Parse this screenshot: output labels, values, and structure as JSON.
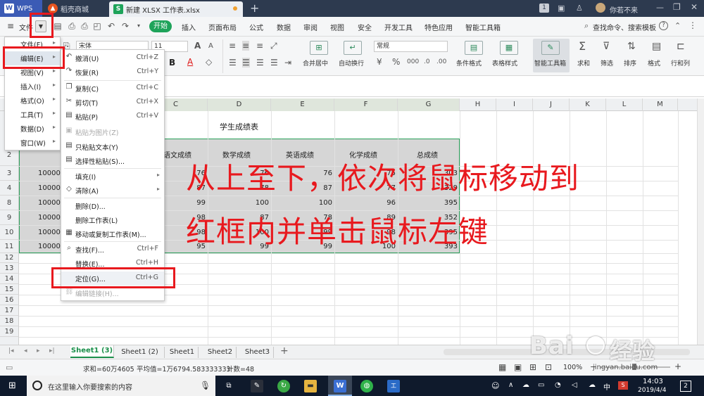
{
  "titlebar": {
    "tabs": [
      {
        "label": "WPS"
      },
      {
        "label": "稻壳商城"
      },
      {
        "label": "新建 XLSX 工作表.xlsx"
      }
    ],
    "page_count": "1",
    "user": "你若不来"
  },
  "menubar": {
    "file_label": "文件",
    "start_label": "开始",
    "items": [
      "插入",
      "页面布局",
      "公式",
      "数据",
      "审阅",
      "视图",
      "安全",
      "开发工具",
      "特色应用",
      "智能工具箱"
    ],
    "search_text": "查找命令、搜索模板"
  },
  "ribbon": {
    "font_name": "宋体",
    "font_size": "11",
    "number_format": "常规",
    "merge_label": "合并居中",
    "wrap_label": "自动换行",
    "cond_format_label": "条件格式",
    "table_style_label": "表格样式",
    "smart_tool_label": "智能工具箱",
    "sum_label": "求和",
    "filter_label": "筛选",
    "sort_label": "排序",
    "format_label": "格式",
    "rowcol_label": "行和列"
  },
  "sheet": {
    "columns": [
      "C",
      "D",
      "E",
      "F",
      "G",
      "H",
      "I",
      "J",
      "K",
      "L",
      "M"
    ],
    "row_numbers": [
      "2",
      "3",
      "4",
      "8",
      "9",
      "10",
      "11",
      "12",
      "13",
      "14",
      "15",
      "16",
      "17",
      "18",
      "19"
    ],
    "title": "学生成绩表",
    "headers": [
      "语文成绩",
      "数学成绩",
      "英语成绩",
      "化学成绩",
      "总成绩"
    ],
    "ids": [
      "10000",
      "10000",
      "10000",
      "10000",
      "10000",
      "10000"
    ],
    "rows": [
      [
        "76",
        "76",
        "76",
        "75",
        "303"
      ],
      [
        "87",
        "78",
        "87",
        "77",
        "329"
      ],
      [
        "99",
        "100",
        "100",
        "96",
        "395"
      ],
      [
        "98",
        "87",
        "78",
        "89",
        "352"
      ],
      [
        "98",
        "100",
        "99",
        "98",
        "395"
      ],
      [
        "95",
        "99",
        "99",
        "100",
        "393"
      ]
    ]
  },
  "annotation": {
    "line1": "从上至下，依次将鼠标移动到",
    "line2": "红框内并单击鼠标左键"
  },
  "main_menu": [
    {
      "label": "文件(F)"
    },
    {
      "label": "编辑(E)"
    },
    {
      "label": "视图(V)"
    },
    {
      "label": "插入(I)"
    },
    {
      "label": "格式(O)"
    },
    {
      "label": "工具(T)"
    },
    {
      "label": "数据(D)"
    },
    {
      "label": "窗口(W)"
    }
  ],
  "edit_menu": [
    {
      "label": "撤消(U)",
      "shortcut": "Ctrl+Z",
      "icon": "undo-icon"
    },
    {
      "label": "恢复(R)",
      "shortcut": "Ctrl+Y",
      "icon": "redo-icon"
    },
    {
      "label": "复制(C)",
      "shortcut": "Ctrl+C",
      "icon": "copy-icon"
    },
    {
      "label": "剪切(T)",
      "shortcut": "Ctrl+X",
      "icon": "cut-icon"
    },
    {
      "label": "粘贴(P)",
      "shortcut": "Ctrl+V",
      "icon": "paste-icon"
    },
    {
      "label": "粘贴为图片(Z)",
      "shortcut": "",
      "icon": "paste-image-icon"
    },
    {
      "label": "只粘贴文本(Y)",
      "shortcut": "",
      "icon": "paste-text-icon"
    },
    {
      "label": "选择性粘贴(S)...",
      "shortcut": "",
      "icon": "paste-special-icon"
    },
    {
      "label": "填充(I)",
      "shortcut": "",
      "icon": ""
    },
    {
      "label": "清除(A)",
      "shortcut": "",
      "icon": "eraser-icon"
    },
    {
      "label": "删除(D)...",
      "shortcut": "",
      "icon": ""
    },
    {
      "label": "删除工作表(L)",
      "shortcut": "",
      "icon": ""
    },
    {
      "label": "移动或复制工作表(M)...",
      "shortcut": "",
      "icon": "move-sheet-icon"
    },
    {
      "label": "查找(F)...",
      "shortcut": "Ctrl+F",
      "icon": "search-icon"
    },
    {
      "label": "替换(E)...",
      "shortcut": "Ctrl+H",
      "icon": ""
    },
    {
      "label": "定位(G)...",
      "shortcut": "Ctrl+G",
      "icon": ""
    },
    {
      "label": "编辑链接(H)...",
      "shortcut": "",
      "icon": "link-icon"
    }
  ],
  "sheet_tabs": [
    "Sheet1 (3)",
    "Sheet1 (2)",
    "Sheet1",
    "Sheet2",
    "Sheet3"
  ],
  "status": {
    "sum": "求和=60万4605",
    "avg": "平均值=1万6794.583333333",
    "count": "计数=48",
    "zoom": "100%"
  },
  "taskbar": {
    "search_placeholder": "在这里输入你要搜索的内容",
    "ime": "中",
    "time": "14:03",
    "date": "2019/4/4",
    "notif": "2"
  },
  "watermark": {
    "brand": "Bai",
    "brand2": "经验",
    "url": "jingyan.baidu.com"
  }
}
